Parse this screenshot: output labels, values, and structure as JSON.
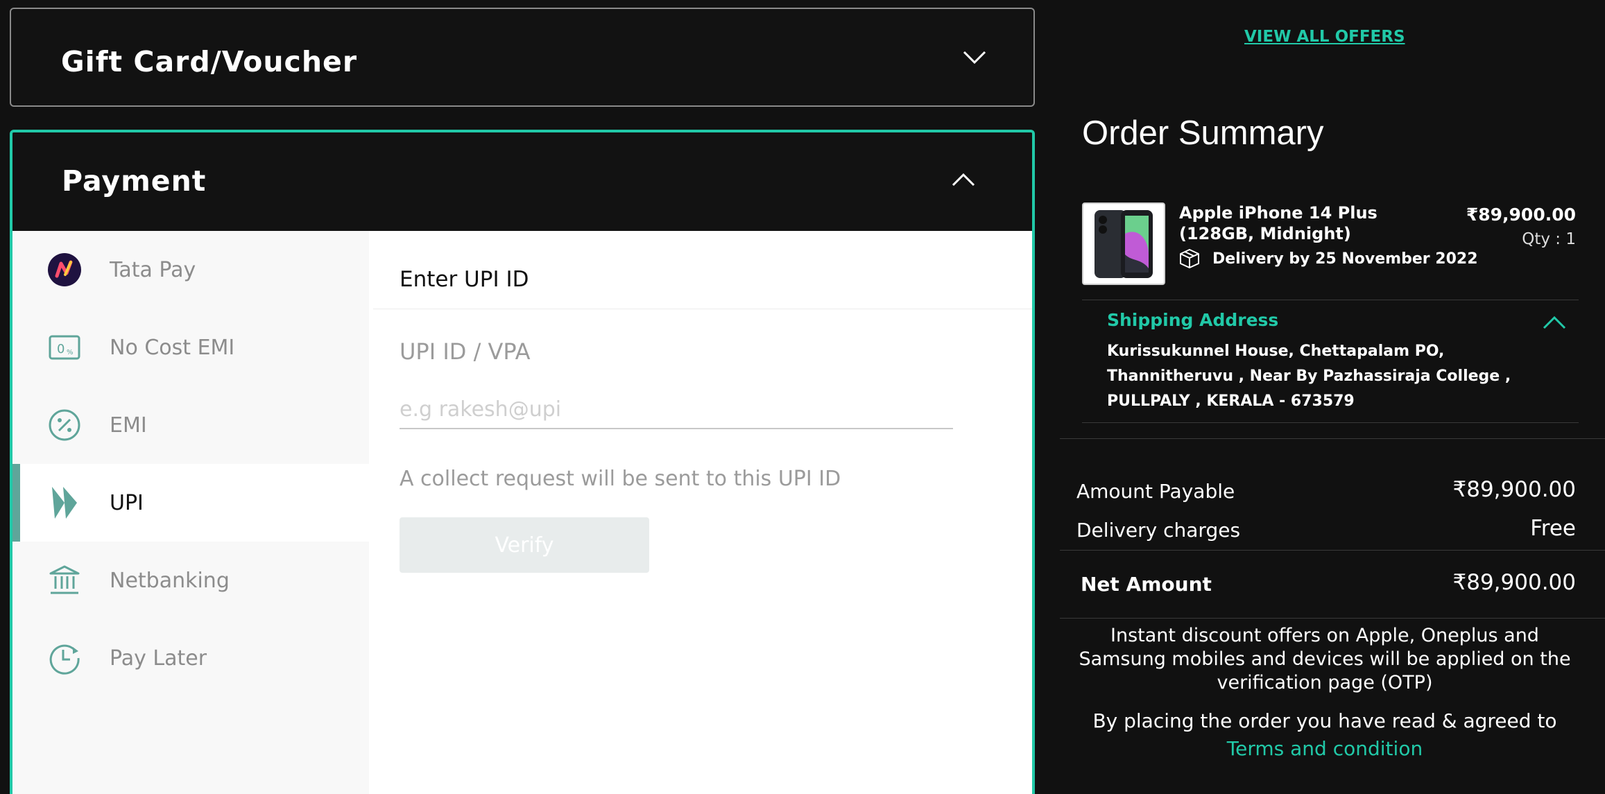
{
  "gift_card": {
    "title": "Gift Card/Voucher"
  },
  "payment": {
    "title": "Payment",
    "methods": [
      {
        "label": "Tata Pay",
        "icon": "tata-pay-icon"
      },
      {
        "label": "No Cost EMI",
        "icon": "no-cost-emi-icon"
      },
      {
        "label": "EMI",
        "icon": "percent-icon"
      },
      {
        "label": "UPI",
        "icon": "upi-icon",
        "active": true
      },
      {
        "label": "Netbanking",
        "icon": "bank-icon"
      },
      {
        "label": "Pay Later",
        "icon": "clock-icon"
      }
    ],
    "upi": {
      "heading": "Enter UPI ID",
      "field_label": "UPI ID / VPA",
      "placeholder": "e.g rakesh@upi",
      "hint": "A collect request will be sent to this UPI ID",
      "verify_label": "Verify"
    }
  },
  "offers_link": "VIEW ALL OFFERS",
  "summary": {
    "title": "Order Summary",
    "product": {
      "name": "Apple iPhone 14 Plus (128GB, Midnight)",
      "price": "₹89,900.00",
      "qty": "Qty : 1",
      "delivery": "Delivery by 25 November 2022"
    },
    "shipping": {
      "title": "Shipping Address",
      "address": "Kurissukunnel House, Chettapalam PO, Thannitheruvu , Near By Pazhassiraja College , PULLPALY , KERALA - 673579"
    },
    "amount_payable_label": "Amount Payable",
    "amount_payable": "₹89,900.00",
    "delivery_label": "Delivery charges",
    "delivery_value": "Free",
    "net_label": "Net Amount",
    "net_value": "₹89,900.00",
    "note": "Instant discount offers on Apple, Oneplus and Samsung mobiles and devices will be applied on the verification page (OTP)",
    "agree": "By placing the order you have read & agreed to",
    "terms": "Terms and condition"
  },
  "colors": {
    "accent": "#21c9a8",
    "background": "#111111",
    "icon_teal": "#5fa59a"
  }
}
